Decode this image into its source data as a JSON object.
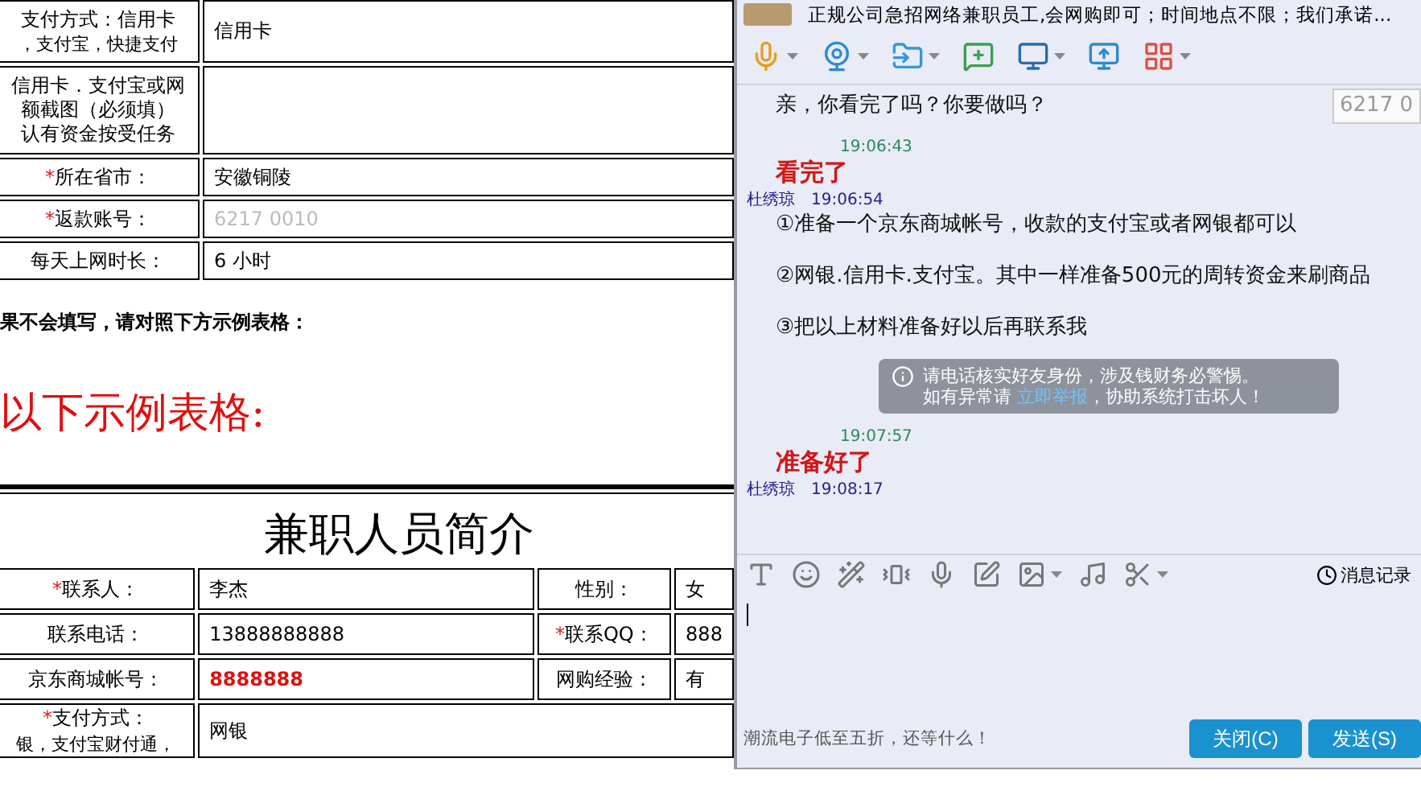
{
  "document": {
    "top_table": [
      {
        "label": [
          "支付方式：信用卡",
          "，支付宝，快捷支付"
        ],
        "value": "信用卡"
      },
      {
        "label": [
          "信用卡．支付宝或网",
          "额截图（必须填）",
          "认有资金按受任务"
        ],
        "blank": true
      },
      {
        "mark": "*",
        "label": [
          "所在省市："
        ],
        "value": "安徽铜陵"
      },
      {
        "mark": "*",
        "label": [
          "返款账号："
        ],
        "value": "6217 0010",
        "faded": true
      },
      {
        "label": [
          "每天上网时长："
        ],
        "value": "6 小时"
      }
    ],
    "note": "果不会填写，请对照下方示例表格：",
    "heading": "以下示例表格:",
    "title": "兼职人员简介",
    "profile_rows": [
      [
        {
          "mark": "*",
          "text": "联系人："
        },
        {
          "text": "李杰"
        },
        {
          "text": "性别："
        },
        {
          "text": "女"
        }
      ],
      [
        {
          "text": "联系电话："
        },
        {
          "text": "13888888888"
        },
        {
          "mark": "*",
          "text": "联系QQ："
        },
        {
          "text": "888"
        }
      ],
      [
        {
          "text": "京东商城帐号："
        },
        {
          "text": "8888888",
          "emphasis": true
        },
        {
          "text": "网购经验："
        },
        {
          "text": "有"
        }
      ],
      [
        {
          "mark": "*",
          "text": "支付方式：",
          "sub": "银，支付宝财付通，"
        },
        {
          "text": "网银"
        }
      ]
    ]
  },
  "chat": {
    "title": "正规公司急招网络兼职员工,会网购即可；时间地点不限；我们承诺...",
    "overlay_field": "6217 0",
    "messages": [
      {
        "kind": "other",
        "paragraphs": [
          "亲，你看完了吗？你要做吗？"
        ]
      },
      {
        "kind": "self",
        "time": "19:06:43",
        "paragraphs": [
          "看完了"
        ]
      },
      {
        "kind": "other",
        "sender": "杜绣琼",
        "time": "19:06:54",
        "paragraphs": [
          "①准备一个京东商城帐号，收款的支付宝或者网银都可以",
          "②网银.信用卡.支付宝。其中一样准备500元的周转资金来刷商品",
          "③把以上材料准备好以后再联系我"
        ]
      },
      {
        "kind": "notice",
        "line1": "请电话核实好友身份，涉及钱财务必警惕。",
        "before": "如有异常请 ",
        "link": "立即举报",
        "after": "，协助系统打击坏人！"
      },
      {
        "kind": "self",
        "time": "19:07:57",
        "paragraphs": [
          "准备好了"
        ]
      },
      {
        "kind": "other",
        "sender": "杜绣琼",
        "time": "19:08:17"
      }
    ],
    "history_label": "消息记录",
    "ad": "潮流电子低至五折，还等什么！",
    "buttons": [
      "关闭(C)",
      "发送(S)"
    ]
  }
}
